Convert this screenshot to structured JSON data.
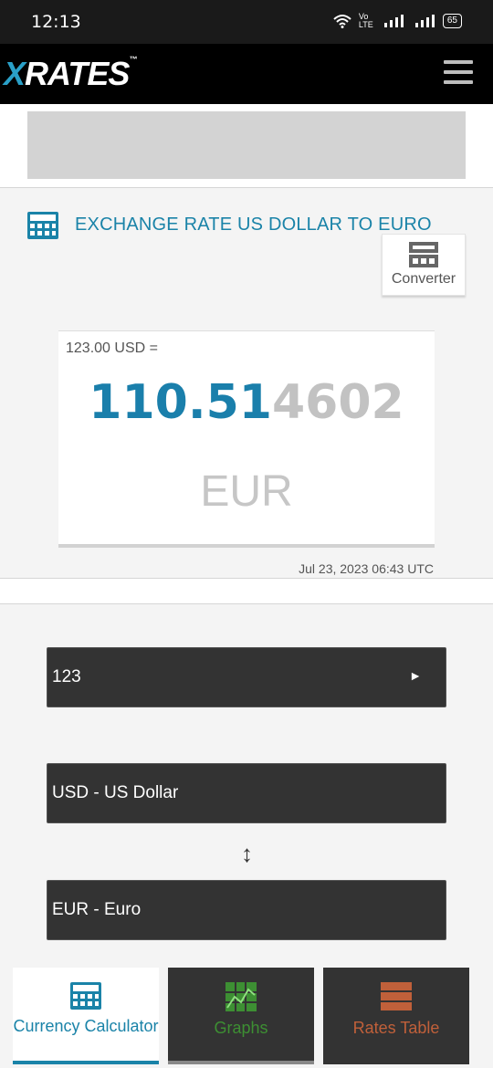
{
  "status_bar": {
    "time": "12:13",
    "network": "Vo LTE",
    "battery": "65"
  },
  "header": {
    "logo_x": "X",
    "logo_rest": "RATES",
    "logo_tm": "™"
  },
  "page": {
    "title": "EXCHANGE RATE US DOLLAR TO EURO",
    "converter_label": "Converter"
  },
  "result": {
    "from_text": "123.00 USD =",
    "amount_main": "110.51",
    "amount_tail": "4602",
    "to_code": "EUR",
    "timestamp": "Jul 23, 2023 06:43 UTC"
  },
  "form": {
    "amount_value": "123",
    "go_arrow": "►",
    "from_currency": "USD - US Dollar",
    "swap_symbol": "↕",
    "to_currency": "EUR - Euro"
  },
  "bottom_nav": {
    "calculator_label": "Currency Calculator",
    "graphs_label": "Graphs",
    "rates_label": "Rates Table"
  },
  "colors": {
    "accent": "#1a83a8",
    "graphs": "#3d8f33",
    "rates": "#c0603a",
    "field_bg": "#333333"
  }
}
